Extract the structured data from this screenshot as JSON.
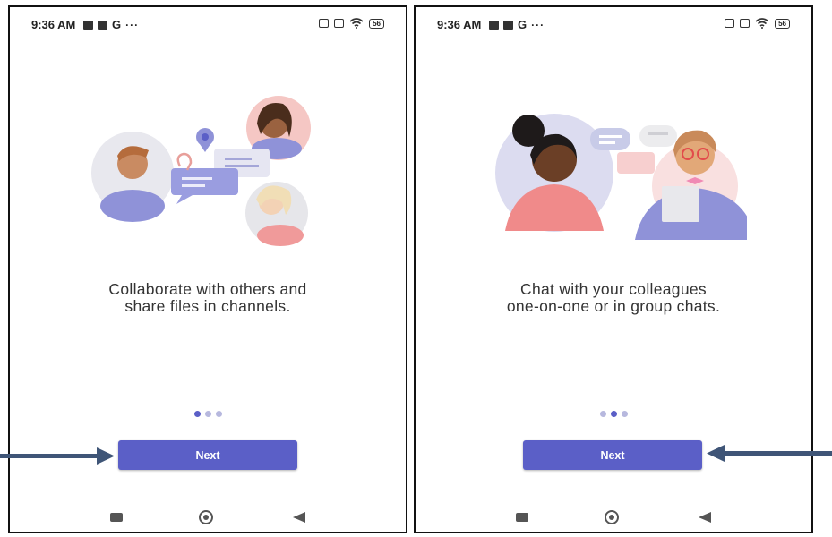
{
  "screens": [
    {
      "status_time": "9:36 AM",
      "status_carrier_icon": "G",
      "status_more": "···",
      "battery": "56",
      "caption_line1": "Collaborate with others and",
      "caption_line2": "share files in channels.",
      "active_page_dot": 1,
      "page_dot_count": 3,
      "next_label": "Next"
    },
    {
      "status_time": "9:36 AM",
      "status_carrier_icon": "G",
      "status_more": "···",
      "battery": "56",
      "caption_line1": "Chat with your colleagues",
      "caption_line2": "one-on-one or in group chats.",
      "active_page_dot": 2,
      "page_dot_count": 3,
      "next_label": "Next"
    }
  ],
  "colors": {
    "accent": "#5b5fc7",
    "dot_inactive": "#b7b8de",
    "annotation_arrow": "#3f5577"
  },
  "annotations": [
    "arrow-pointing-to-next-left",
    "arrow-pointing-to-next-right"
  ]
}
